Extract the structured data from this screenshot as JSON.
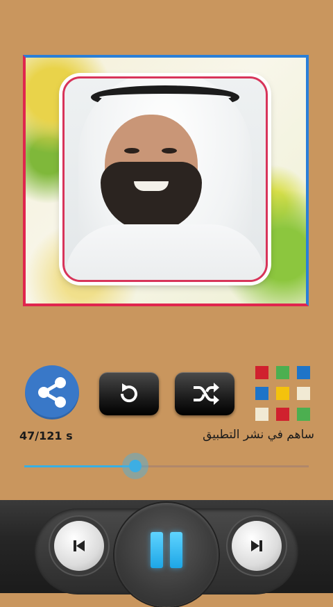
{
  "player": {
    "time_label": "47/121 s",
    "progress_fraction": 0.39
  },
  "promo": {
    "label": "ساهم في نشر التطبيق"
  },
  "icons": {
    "share": "share-icon",
    "repeat": "repeat-icon",
    "shuffle": "shuffle-icon",
    "more_apps": "apps-grid-icon",
    "previous": "skip-previous-icon",
    "pause": "pause-icon",
    "next": "skip-next-icon"
  },
  "colors": {
    "background": "#c9965e",
    "accent_blue": "#3978c8",
    "seek_accent": "#37b0e4",
    "frame_blue": "#2a7fd8",
    "frame_red": "#e0264e"
  },
  "apps_grid_colors": [
    "#d0212e",
    "#4caf50",
    "#1e74c8",
    "#1e74c8",
    "#f4c20d",
    "#f1ead4",
    "#f1ead4",
    "#d0212e",
    "#4caf50"
  ]
}
